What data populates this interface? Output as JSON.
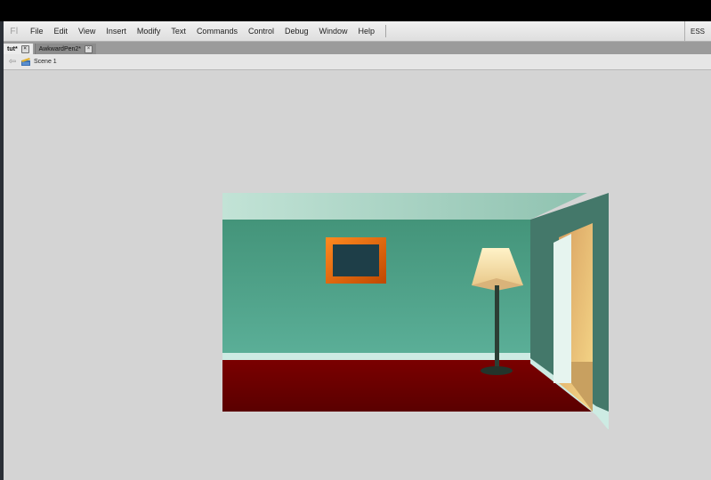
{
  "app": {
    "logo_text": "Fl"
  },
  "menu": {
    "items": [
      "File",
      "Edit",
      "View",
      "Insert",
      "Modify",
      "Text",
      "Commands",
      "Control",
      "Debug",
      "Window",
      "Help"
    ]
  },
  "workspace_label": "ESS",
  "tabs": [
    {
      "label": "tut*",
      "active": true
    },
    {
      "label": "AwkwardPen2*",
      "active": false
    }
  ],
  "edit_bar": {
    "scene_label": "Scene 1"
  },
  "colors": {
    "wall_top": "#b6dccc",
    "wall_bottom": "#5fb29a",
    "floor": "#6b0000",
    "door_light": "#f5d88a"
  }
}
